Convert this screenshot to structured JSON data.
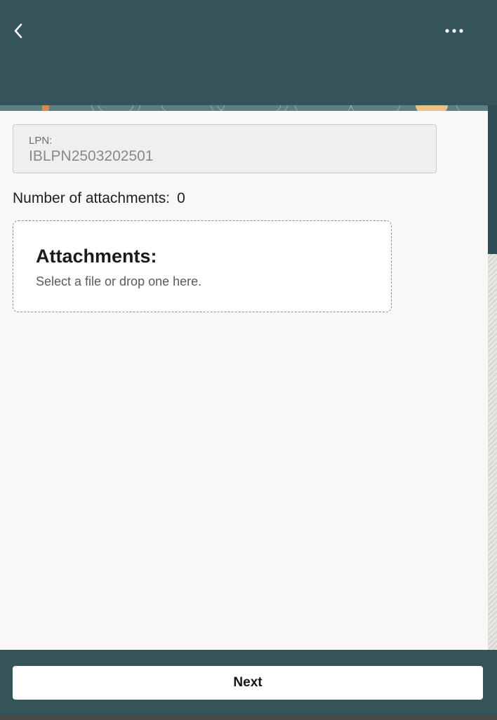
{
  "header": {
    "back_icon": "chevron-left-icon",
    "more_icon": "more-horizontal-icon"
  },
  "form": {
    "lpn_label": "LPN:",
    "lpn_value": "IBLPN2503202501",
    "attachments_count_label": "Number of attachments:",
    "attachments_count_value": "0"
  },
  "dropzone": {
    "title": "Attachments:",
    "hint": "Select a file or drop one here."
  },
  "footer": {
    "next_label": "Next"
  },
  "colors": {
    "header_bg": "#34545a",
    "content_bg": "#f9f8f6",
    "button_bg": "#ffffff"
  }
}
